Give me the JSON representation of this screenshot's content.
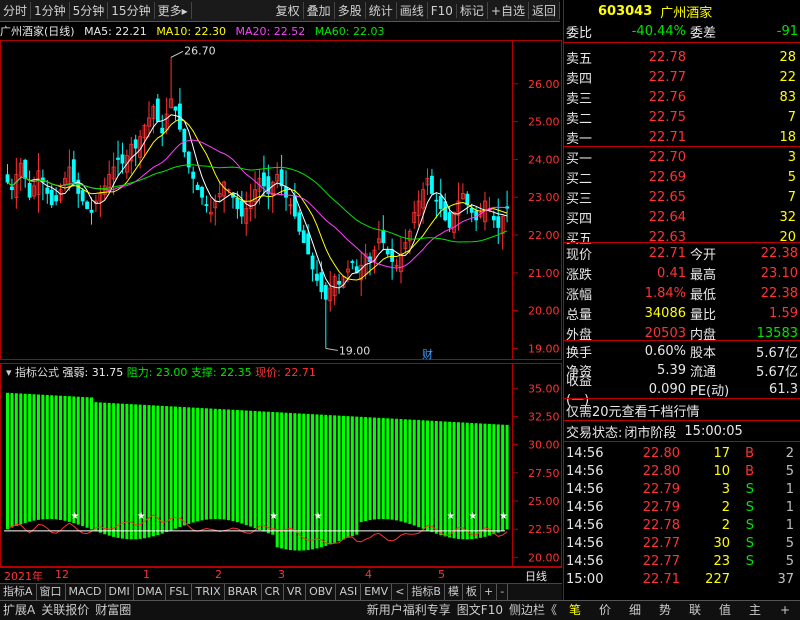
{
  "toolbar": {
    "items": [
      "分时",
      "1分钟",
      "5分钟",
      "15分钟",
      "更多▸",
      "复权",
      "叠加",
      "多股",
      "统计",
      "画线",
      "F10",
      "标记",
      "+自选",
      "返回"
    ]
  },
  "title": {
    "name": "广州酒家(日线)",
    "ma5": "MA5: 22.21",
    "ma10": "MA10: 22.30",
    "ma20": "MA20: 22.52",
    "ma60": "MA60: 22.03"
  },
  "annotations": {
    "high": "26.70",
    "low": "19.00",
    "cai": "财"
  },
  "indicator": {
    "label": "指标公式",
    "strength": "强弱: 31.75",
    "resist": "阻力: 23.00",
    "support": "支撑: 22.35",
    "price": "现价: 22.71"
  },
  "xaxis": {
    "ticks": [
      "2021年",
      "12",
      "1",
      "2",
      "3",
      "4",
      "5"
    ],
    "right": "日线"
  },
  "tabs": [
    "指标A",
    "窗口",
    "MACD",
    "DMI",
    "DMA",
    "FSL",
    "TRIX",
    "BRAR",
    "CR",
    "VR",
    "OBV",
    "ASI",
    "EMV",
    "<",
    "指标B",
    "模",
    "板",
    "+",
    "-"
  ],
  "bottom": {
    "left": [
      "扩展A",
      "关联报价",
      "财富圈"
    ],
    "ad": "新用户福利专享",
    "mid": [
      "图文F10",
      "侧边栏《"
    ],
    "right": [
      "笔",
      "价",
      "细",
      "势",
      "联",
      "值",
      "主",
      "+"
    ]
  },
  "stock": {
    "code": "603043",
    "name": "广州酒家",
    "weibi_label": "委比",
    "weibi": "-40.44%",
    "weicha_label": "委差",
    "weicha": "-91"
  },
  "asks": [
    {
      "label": "卖五",
      "price": "22.78",
      "vol": "28"
    },
    {
      "label": "卖四",
      "price": "22.77",
      "vol": "22"
    },
    {
      "label": "卖三",
      "price": "22.76",
      "vol": "83"
    },
    {
      "label": "卖二",
      "price": "22.75",
      "vol": "7"
    },
    {
      "label": "卖一",
      "price": "22.71",
      "vol": "18"
    }
  ],
  "bids": [
    {
      "label": "买一",
      "price": "22.70",
      "vol": "3"
    },
    {
      "label": "买二",
      "price": "22.69",
      "vol": "5"
    },
    {
      "label": "买三",
      "price": "22.65",
      "vol": "7"
    },
    {
      "label": "买四",
      "price": "22.64",
      "vol": "32"
    },
    {
      "label": "买五",
      "price": "22.63",
      "vol": "20"
    }
  ],
  "quote": [
    {
      "l1": "现价",
      "v1": "22.71",
      "c1": "red",
      "l2": "今开",
      "v2": "22.38",
      "c2": "red"
    },
    {
      "l1": "涨跌",
      "v1": "0.41",
      "c1": "red",
      "l2": "最高",
      "v2": "23.10",
      "c2": "red"
    },
    {
      "l1": "涨幅",
      "v1": "1.84%",
      "c1": "red",
      "l2": "最低",
      "v2": "22.38",
      "c2": "red"
    },
    {
      "l1": "总量",
      "v1": "34086",
      "c1": "yel",
      "l2": "量比",
      "v2": "1.59",
      "c2": "red"
    },
    {
      "l1": "外盘",
      "v1": "20503",
      "c1": "red",
      "l2": "内盘",
      "v2": "13583",
      "c2": "grn"
    }
  ],
  "quote2": [
    {
      "l1": "换手",
      "v1": "0.60%",
      "l2": "股本",
      "v2": "5.67亿"
    },
    {
      "l1": "净资",
      "v1": "5.39",
      "l2": "流通",
      "v2": "5.67亿"
    },
    {
      "l1": "收益(一)",
      "v1": "0.090",
      "l2": "PE(动)",
      "v2": "61.3"
    }
  ],
  "promo": "仅需20元查看千档行情",
  "trade_status": {
    "label": "交易状态:",
    "value": "闭市阶段",
    "time": "15:00:05"
  },
  "ticks": [
    {
      "t": "14:56",
      "p": "22.80",
      "v": "17",
      "d": "B",
      "n": "2"
    },
    {
      "t": "14:56",
      "p": "22.80",
      "v": "10",
      "d": "B",
      "n": "5"
    },
    {
      "t": "14:56",
      "p": "22.79",
      "v": "3",
      "d": "S",
      "n": "1"
    },
    {
      "t": "14:56",
      "p": "22.79",
      "v": "2",
      "d": "S",
      "n": "1"
    },
    {
      "t": "14:56",
      "p": "22.78",
      "v": "2",
      "d": "S",
      "n": "1"
    },
    {
      "t": "14:56",
      "p": "22.77",
      "v": "30",
      "d": "S",
      "n": "5"
    },
    {
      "t": "14:56",
      "p": "22.77",
      "v": "23",
      "d": "S",
      "n": "5"
    },
    {
      "t": "15:00",
      "p": "22.71",
      "v": "227",
      "d": "",
      "n": "37"
    }
  ],
  "colors": {
    "up": "#ff3232",
    "down": "#00ffff",
    "ma5": "#ffffff",
    "ma10": "#ffff00",
    "ma20": "#ff40ff",
    "ma60": "#00e600",
    "frame": "#b00000"
  },
  "chart_data": [
    {
      "type": "candlestick",
      "title": "广州酒家(日线)",
      "ylim": [
        18.8,
        27.0
      ],
      "yticks": [
        19,
        20,
        21,
        22,
        23,
        24,
        25,
        26
      ],
      "x_labels": [
        "2021年",
        "12",
        "1",
        "2",
        "3",
        "4",
        "5"
      ],
      "ma": {
        "MA5": 22.21,
        "MA10": 22.3,
        "MA20": 22.52,
        "MA60": 22.03
      },
      "annotations": [
        {
          "text": "26.70",
          "value": 26.7
        },
        {
          "text": "19.00",
          "value": 19.0
        }
      ],
      "closes": [
        23.4,
        23.2,
        23.6,
        23.9,
        23.5,
        23.0,
        23.3,
        23.7,
        23.4,
        23.1,
        22.8,
        22.9,
        23.2,
        23.5,
        23.8,
        23.4,
        23.1,
        22.9,
        22.7,
        22.6,
        22.9,
        23.1,
        23.3,
        23.6,
        23.8,
        24.0,
        23.9,
        24.1,
        24.4,
        24.3,
        24.6,
        24.9,
        25.1,
        25.4,
        25.0,
        24.7,
        25.2,
        25.6,
        25.3,
        24.8,
        24.2,
        23.8,
        23.5,
        23.2,
        23.0,
        22.8,
        22.6,
        22.9,
        23.1,
        23.4,
        23.2,
        23.0,
        22.7,
        22.5,
        22.7,
        22.9,
        23.2,
        23.5,
        23.3,
        23.1,
        23.4,
        23.6,
        23.3,
        23.0,
        22.8,
        22.5,
        22.1,
        21.8,
        21.5,
        21.1,
        20.8,
        20.5,
        20.3,
        20.6,
        20.9,
        20.7,
        20.9,
        21.1,
        21.3,
        21.0,
        21.2,
        21.5,
        21.3,
        21.6,
        21.9,
        21.8,
        21.5,
        21.3,
        21.2,
        21.5,
        21.8,
        22.1,
        22.6,
        22.9,
        23.2,
        23.5,
        23.1,
        22.9,
        22.7,
        22.4,
        22.2,
        22.6,
        22.9,
        23.1,
        22.8,
        22.6,
        22.4,
        22.6,
        22.9,
        22.7,
        22.4,
        22.2,
        22.5,
        22.71
      ]
    },
    {
      "type": "bar",
      "title": "指标公式",
      "ylim": [
        19.5,
        36.0
      ],
      "yticks": [
        20.0,
        22.5,
        25.0,
        27.5,
        30.0,
        32.5,
        35.0
      ],
      "series": [
        {
          "name": "强弱",
          "last": 31.75
        },
        {
          "name": "阻力",
          "last": 23.0
        },
        {
          "name": "支撑",
          "last": 22.35
        },
        {
          "name": "现价",
          "last": 22.71
        }
      ],
      "top_start": 34.2,
      "top_end": 31.75
    }
  ]
}
